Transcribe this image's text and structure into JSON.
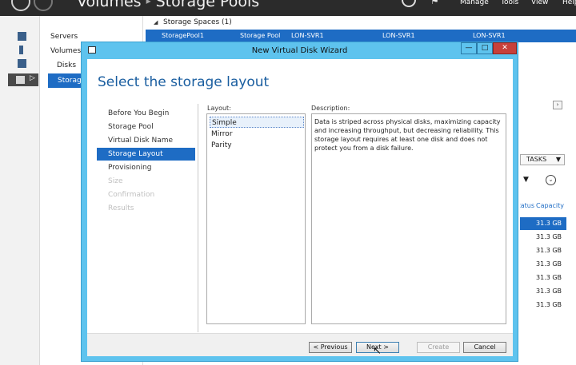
{
  "server_manager": {
    "breadcrumb": [
      "Volumes",
      "Storage Pools"
    ],
    "breadcrumb_sep": "▸",
    "menu": {
      "manage": "Manage",
      "tools": "Tools",
      "view": "View",
      "help": "Help"
    },
    "nav": {
      "servers": "Servers",
      "volumes": "Volumes",
      "disks": "Disks",
      "storage_pools": "Storage Pools"
    },
    "pools_group": "Storage Spaces (1)",
    "pool_row": {
      "name": "StoragePool1",
      "type": "Storage Pool",
      "managed_by": "LON-SVR1",
      "available_to": "LON-SVR1",
      "read_write_server": "LON-SVR1"
    },
    "tasks_label": "TASKS",
    "columns": {
      "status": "Status",
      "capacity": "Capacity"
    },
    "capacities": [
      "31.3 GB",
      "31.3 GB",
      "31.3 GB",
      "31.3 GB",
      "31.3 GB",
      "31.3 GB",
      "31.3 GB"
    ]
  },
  "wizard": {
    "title": "New Virtual Disk Wizard",
    "heading": "Select the storage layout",
    "steps": [
      {
        "label": "Before You Begin",
        "state": "done"
      },
      {
        "label": "Storage Pool",
        "state": "done"
      },
      {
        "label": "Virtual Disk Name",
        "state": "done"
      },
      {
        "label": "Storage Layout",
        "state": "current"
      },
      {
        "label": "Provisioning",
        "state": "todo"
      },
      {
        "label": "Size",
        "state": "disabled"
      },
      {
        "label": "Confirmation",
        "state": "disabled"
      },
      {
        "label": "Results",
        "state": "disabled"
      }
    ],
    "layout_label": "Layout:",
    "layout_options": [
      "Simple",
      "Mirror",
      "Parity"
    ],
    "selected_layout": "Simple",
    "description_label": "Description:",
    "description": "Data is striped across physical disks, maximizing capacity and increasing throughput, but decreasing reliability. This storage layout requires at least one disk and does not protect you from a disk failure.",
    "buttons": {
      "previous": "< Previous",
      "next": "Next >",
      "create": "Create",
      "cancel": "Cancel"
    }
  },
  "icons": {
    "close": "✕",
    "minimize": "—",
    "maximize": "□",
    "caret_down": "▼",
    "expand": "⌄",
    "scroll_right": "›",
    "triangle_down": "◢",
    "cursor": "↖"
  },
  "colors": {
    "selection": "#1e6cc4",
    "wizard_frame": "#5ec3ee",
    "heading": "#1a5ea0",
    "close": "#c7403a"
  }
}
